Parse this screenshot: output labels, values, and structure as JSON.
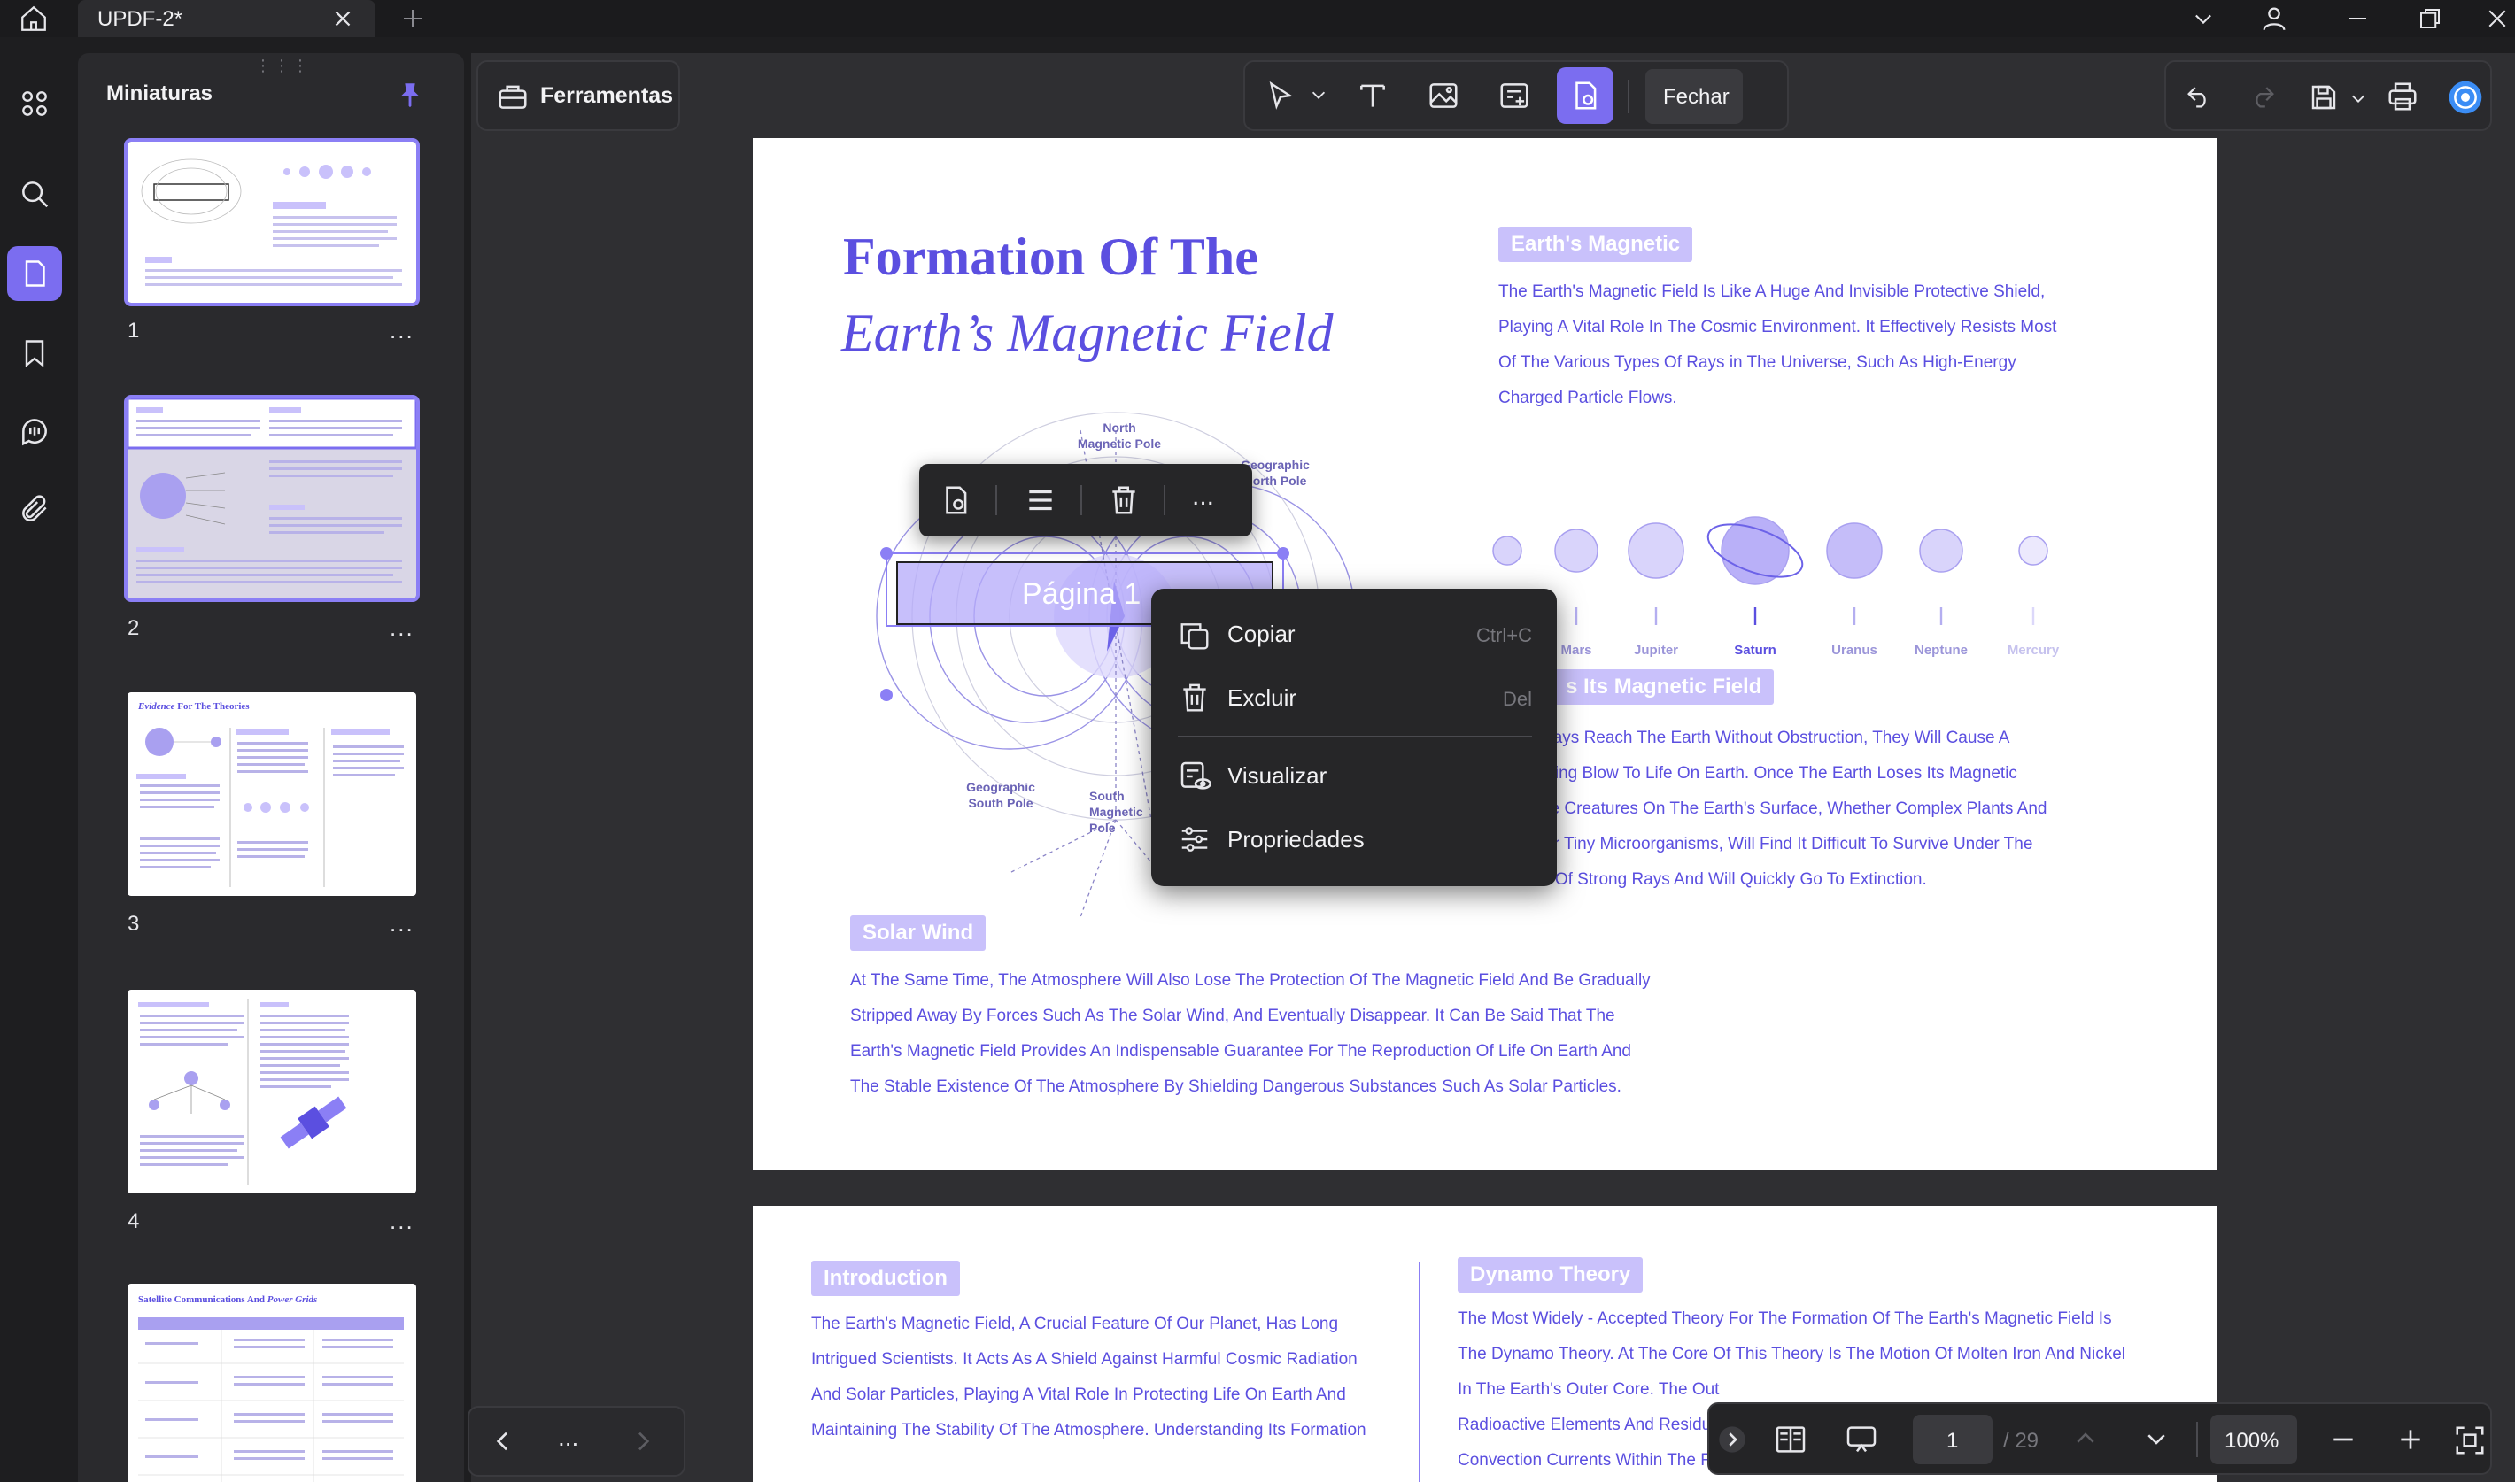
{
  "window": {
    "tab_title": "UPDF-2*"
  },
  "sidebar": {
    "title": "Miniaturas",
    "pages": [
      "1",
      "2",
      "3",
      "4"
    ],
    "more": "..."
  },
  "thumbs": {
    "t3_title": "Evidence",
    "t3_title_b": "For The Theories",
    "t5_title": "Satellite Communications And",
    "t5_title_b": "Power Grids"
  },
  "toolbar": {
    "tools_label": "Ferramentas",
    "close_label": "Fechar"
  },
  "element_toolbar": {
    "more": "..."
  },
  "context_menu": {
    "copy": "Copiar",
    "copy_key": "Ctrl+C",
    "delete": "Excluir",
    "delete_key": "Del",
    "view": "Visualizar",
    "properties": "Propriedades"
  },
  "page1": {
    "title_line1": "Formation Of The",
    "title_line2": "Earth’s Magnetic Field",
    "chip_magnetic": "Earth's Magnetic",
    "para_magnetic": [
      "The Earth's Magnetic Field Is Like A Huge And Invisible Protective Shield,",
      "Playing A Vital Role In The Cosmic Environment. It Effectively Resists Most",
      "Of The Various Types Of Rays in The Universe, Such As High-Energy",
      "Charged Particle Flows."
    ],
    "planets": [
      "Mars",
      "Jupiter",
      "Saturn",
      "Uranus",
      "Neptune",
      "Mercury"
    ],
    "chip_loses": "s Its Magnetic Field",
    "para_loses": [
      "Rays Reach The Earth Without Obstruction, They Will Cause A",
      "ating Blow To Life On Earth. Once The Earth Loses Its Magnetic",
      "he Creatures On The Earth's Surface, Whether Complex Plants And",
      "Or Tiny Microorganisms, Will Find It Difficult To Survive Under The",
      "n Of Strong Rays And Will Quickly Go To Extinction."
    ],
    "label_north_mag": "North\nMagnetic Pole",
    "label_geo_north": "Geographic\nNorth Pole",
    "label_geo_south": "Geographic\nSouth Pole",
    "label_south_mag": "South\nMagnetic\nPole",
    "stamp_text": "Página 1",
    "chip_solar": "Solar Wind",
    "para_solar": [
      "At The Same Time, The Atmosphere Will Also Lose The Protection Of The Magnetic Field And Be Gradually",
      "Stripped Away By Forces Such As The Solar Wind, And Eventually Disappear. It Can Be Said That The",
      "Earth's Magnetic Field Provides An Indispensable Guarantee For The Reproduction Of Life On Earth And",
      "The Stable Existence Of The Atmosphere By Shielding Dangerous Substances Such As Solar Particles."
    ]
  },
  "page2": {
    "chip_intro": "Introduction",
    "para_intro": [
      "The Earth's Magnetic Field, A Crucial Feature Of Our Planet, Has Long",
      "Intrigued Scientists. It Acts As A Shield Against Harmful Cosmic Radiation",
      "And Solar Particles, Playing A Vital Role In Protecting Life On Earth And",
      "Maintaining The Stability Of The Atmosphere. Understanding Its Formation"
    ],
    "chip_dynamo": "Dynamo Theory",
    "para_dynamo": [
      "The Most Widely - Accepted Theory For The Formation Of The Earth's Magnetic Field Is",
      "The Dynamo Theory. At The Core Of This Theory Is The Motion Of Molten Iron And Nickel",
      "In The Earth's Outer Core. The Out",
      "Radioactive Elements And Residu",
      "Convection Currents Within The Fluid"
    ]
  },
  "pagination": {
    "current": "1",
    "total": "/ 29",
    "zoom": "100%"
  },
  "colors": {
    "accent": "#7b6df0",
    "pdf_text": "#5b4fe0",
    "chip": "#c9c1fb"
  }
}
